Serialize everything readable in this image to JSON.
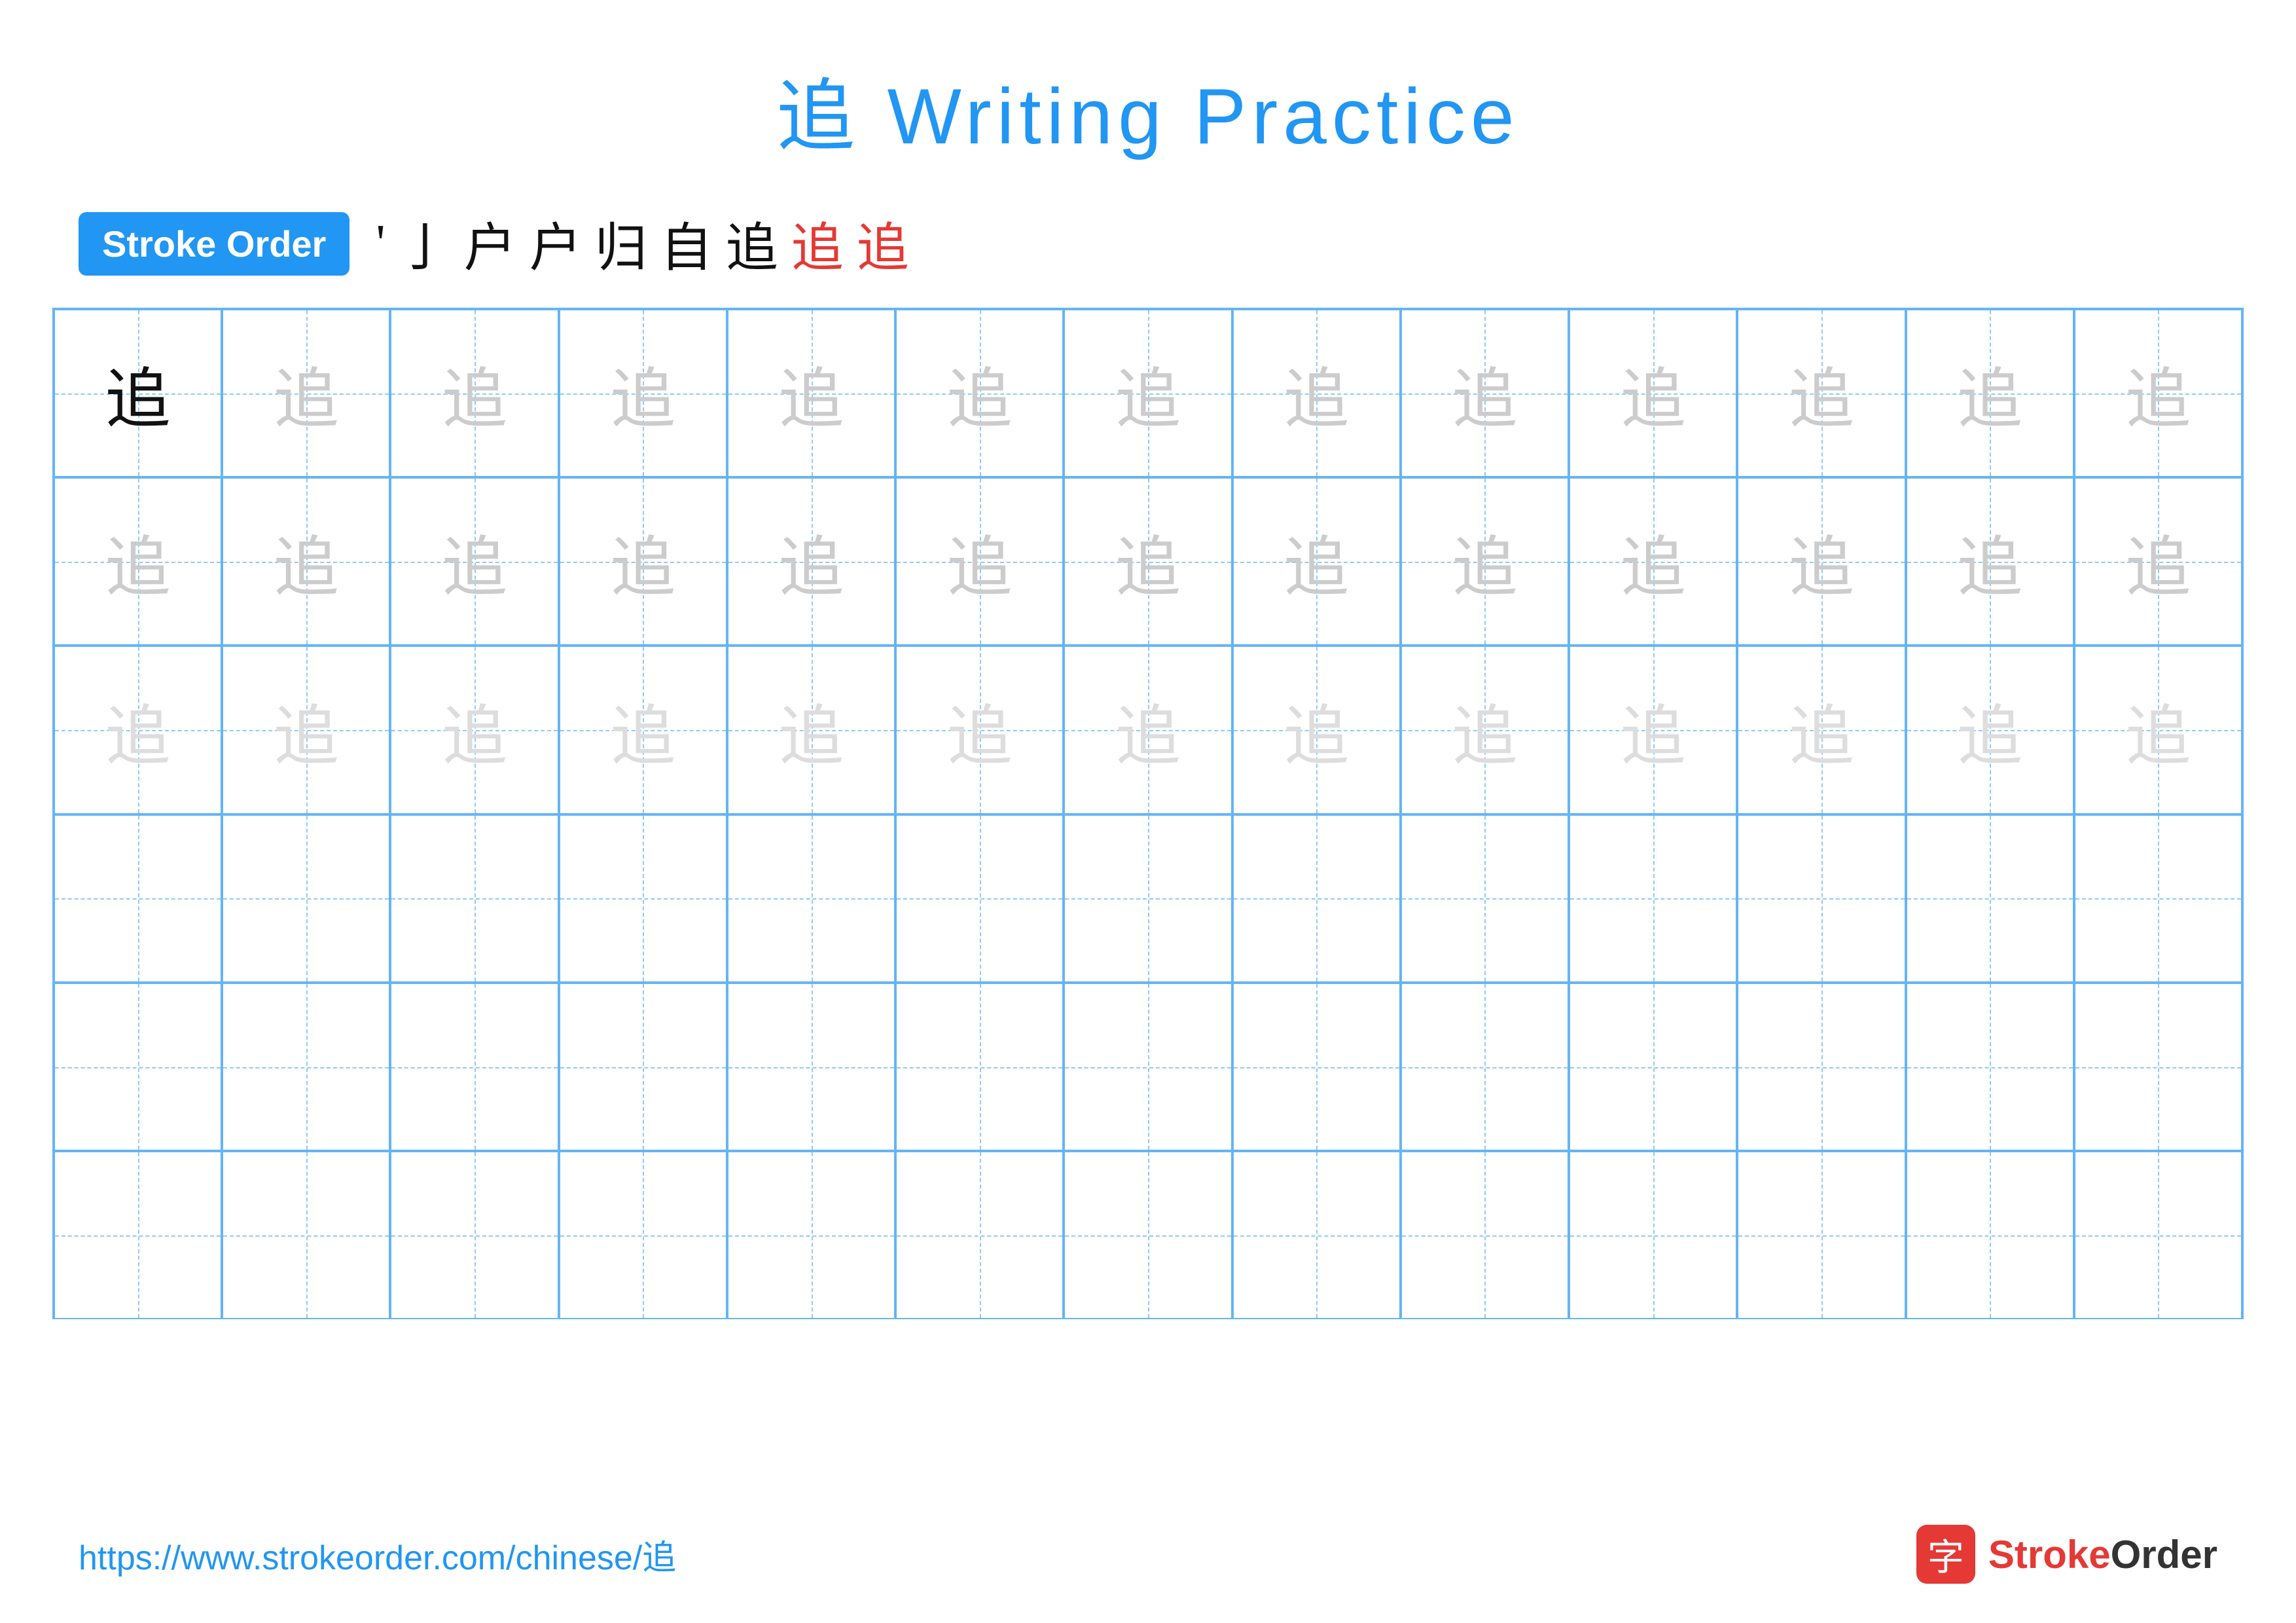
{
  "title": "追 Writing Practice",
  "stroke_order": {
    "badge_label": "Stroke Order",
    "strokes": [
      {
        "char": "丶",
        "style": "normal"
      },
      {
        "char": "亅",
        "style": "normal"
      },
      {
        "char": "户",
        "style": "normal"
      },
      {
        "char": "户",
        "style": "normal"
      },
      {
        "char": "归",
        "style": "normal"
      },
      {
        "char": "自",
        "style": "normal"
      },
      {
        "char": "追",
        "style": "normal"
      },
      {
        "char": "追",
        "style": "red-partial"
      },
      {
        "char": "追",
        "style": "red"
      }
    ]
  },
  "grid": {
    "cols": 13,
    "rows": 6,
    "character": "追",
    "row_styles": [
      "solid",
      "light",
      "lighter",
      "empty",
      "empty",
      "empty"
    ]
  },
  "footer": {
    "url": "https://www.strokeorder.com/chinese/追",
    "logo_char": "字",
    "logo_name": "StrokeOrder"
  }
}
